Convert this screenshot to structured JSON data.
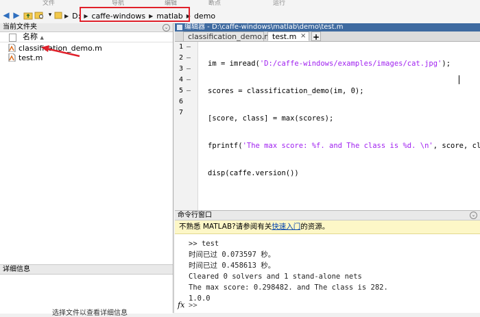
{
  "ribbon": {
    "sections": [
      "文件",
      "导航",
      "编辑",
      "断点",
      "运行"
    ]
  },
  "toolbar": {
    "back_icon": "back-arrow-icon",
    "forward_icon": "forward-arrow-icon",
    "up_icon": "up-folder-icon",
    "browse_icon": "browse-folder-icon",
    "path": [
      "D:",
      "caffe-windows",
      "matlab",
      "demo"
    ]
  },
  "current_folder": {
    "title": "当前文件夹",
    "column_header": "名称",
    "files": [
      {
        "name": "classification_demo.m",
        "icon": "matlab-script-icon"
      },
      {
        "name": "test.m",
        "icon": "matlab-script-icon"
      }
    ],
    "details_title": "详细信息",
    "details_message": "选择文件以查看详细信息"
  },
  "editor": {
    "title": "编辑器 - D:\\caffe-windows\\matlab\\demo\\test.m",
    "tabs": [
      {
        "label": "classification_demo.m",
        "active": false
      },
      {
        "label": "test.m",
        "active": true
      }
    ],
    "add_tab": "+",
    "close_tab": "×",
    "lines": [
      {
        "n": "1",
        "pre": "im = imread(",
        "str": "'D:/caffe-windows/examples/images/cat.jpg'",
        "post": ");"
      },
      {
        "n": "2",
        "pre": "scores = classification_demo(im, 0);",
        "str": "",
        "post": ""
      },
      {
        "n": "3",
        "pre": "[score, class] = max(scores);",
        "str": "",
        "post": ""
      },
      {
        "n": "4",
        "pre": "fprintf(",
        "str": "'The max score: %f. and The class is %d. \\n'",
        "post": ", score, class);"
      },
      {
        "n": "5",
        "pre": "disp(caffe.version())",
        "str": "",
        "post": ""
      },
      {
        "n": "6",
        "pre": "",
        "str": "",
        "post": ""
      },
      {
        "n": "7",
        "pre": "",
        "str": "",
        "post": ""
      }
    ],
    "dash": "—"
  },
  "command_window": {
    "title": "命令行窗口",
    "notice_pre": "不熟悉 MATLAB?请参阅有关",
    "notice_link": "快速入门",
    "notice_post": "的资源。",
    "output": [
      ">> test",
      "时间已过 0.073597 秒。",
      "时间已过 0.458613 秒。",
      "Cleared 0 solvers and 1 stand-alone nets",
      "The max score: 0.298482. and The class is 282.",
      "1.0.0"
    ],
    "fx": "fx",
    "prompt": ">>"
  }
}
